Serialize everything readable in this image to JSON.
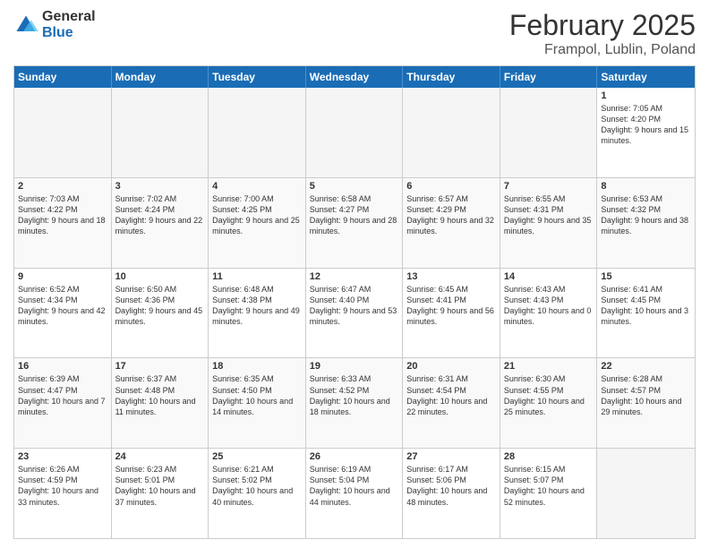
{
  "header": {
    "logo": {
      "general": "General",
      "blue": "Blue"
    },
    "title": "February 2025",
    "location": "Frampol, Lublin, Poland"
  },
  "days_of_week": [
    "Sunday",
    "Monday",
    "Tuesday",
    "Wednesday",
    "Thursday",
    "Friday",
    "Saturday"
  ],
  "weeks": [
    [
      {
        "day": "",
        "info": ""
      },
      {
        "day": "",
        "info": ""
      },
      {
        "day": "",
        "info": ""
      },
      {
        "day": "",
        "info": ""
      },
      {
        "day": "",
        "info": ""
      },
      {
        "day": "",
        "info": ""
      },
      {
        "day": "1",
        "info": "Sunrise: 7:05 AM\nSunset: 4:20 PM\nDaylight: 9 hours and 15 minutes."
      }
    ],
    [
      {
        "day": "2",
        "info": "Sunrise: 7:03 AM\nSunset: 4:22 PM\nDaylight: 9 hours and 18 minutes."
      },
      {
        "day": "3",
        "info": "Sunrise: 7:02 AM\nSunset: 4:24 PM\nDaylight: 9 hours and 22 minutes."
      },
      {
        "day": "4",
        "info": "Sunrise: 7:00 AM\nSunset: 4:25 PM\nDaylight: 9 hours and 25 minutes."
      },
      {
        "day": "5",
        "info": "Sunrise: 6:58 AM\nSunset: 4:27 PM\nDaylight: 9 hours and 28 minutes."
      },
      {
        "day": "6",
        "info": "Sunrise: 6:57 AM\nSunset: 4:29 PM\nDaylight: 9 hours and 32 minutes."
      },
      {
        "day": "7",
        "info": "Sunrise: 6:55 AM\nSunset: 4:31 PM\nDaylight: 9 hours and 35 minutes."
      },
      {
        "day": "8",
        "info": "Sunrise: 6:53 AM\nSunset: 4:32 PM\nDaylight: 9 hours and 38 minutes."
      }
    ],
    [
      {
        "day": "9",
        "info": "Sunrise: 6:52 AM\nSunset: 4:34 PM\nDaylight: 9 hours and 42 minutes."
      },
      {
        "day": "10",
        "info": "Sunrise: 6:50 AM\nSunset: 4:36 PM\nDaylight: 9 hours and 45 minutes."
      },
      {
        "day": "11",
        "info": "Sunrise: 6:48 AM\nSunset: 4:38 PM\nDaylight: 9 hours and 49 minutes."
      },
      {
        "day": "12",
        "info": "Sunrise: 6:47 AM\nSunset: 4:40 PM\nDaylight: 9 hours and 53 minutes."
      },
      {
        "day": "13",
        "info": "Sunrise: 6:45 AM\nSunset: 4:41 PM\nDaylight: 9 hours and 56 minutes."
      },
      {
        "day": "14",
        "info": "Sunrise: 6:43 AM\nSunset: 4:43 PM\nDaylight: 10 hours and 0 minutes."
      },
      {
        "day": "15",
        "info": "Sunrise: 6:41 AM\nSunset: 4:45 PM\nDaylight: 10 hours and 3 minutes."
      }
    ],
    [
      {
        "day": "16",
        "info": "Sunrise: 6:39 AM\nSunset: 4:47 PM\nDaylight: 10 hours and 7 minutes."
      },
      {
        "day": "17",
        "info": "Sunrise: 6:37 AM\nSunset: 4:48 PM\nDaylight: 10 hours and 11 minutes."
      },
      {
        "day": "18",
        "info": "Sunrise: 6:35 AM\nSunset: 4:50 PM\nDaylight: 10 hours and 14 minutes."
      },
      {
        "day": "19",
        "info": "Sunrise: 6:33 AM\nSunset: 4:52 PM\nDaylight: 10 hours and 18 minutes."
      },
      {
        "day": "20",
        "info": "Sunrise: 6:31 AM\nSunset: 4:54 PM\nDaylight: 10 hours and 22 minutes."
      },
      {
        "day": "21",
        "info": "Sunrise: 6:30 AM\nSunset: 4:55 PM\nDaylight: 10 hours and 25 minutes."
      },
      {
        "day": "22",
        "info": "Sunrise: 6:28 AM\nSunset: 4:57 PM\nDaylight: 10 hours and 29 minutes."
      }
    ],
    [
      {
        "day": "23",
        "info": "Sunrise: 6:26 AM\nSunset: 4:59 PM\nDaylight: 10 hours and 33 minutes."
      },
      {
        "day": "24",
        "info": "Sunrise: 6:23 AM\nSunset: 5:01 PM\nDaylight: 10 hours and 37 minutes."
      },
      {
        "day": "25",
        "info": "Sunrise: 6:21 AM\nSunset: 5:02 PM\nDaylight: 10 hours and 40 minutes."
      },
      {
        "day": "26",
        "info": "Sunrise: 6:19 AM\nSunset: 5:04 PM\nDaylight: 10 hours and 44 minutes."
      },
      {
        "day": "27",
        "info": "Sunrise: 6:17 AM\nSunset: 5:06 PM\nDaylight: 10 hours and 48 minutes."
      },
      {
        "day": "28",
        "info": "Sunrise: 6:15 AM\nSunset: 5:07 PM\nDaylight: 10 hours and 52 minutes."
      },
      {
        "day": "",
        "info": ""
      }
    ]
  ]
}
